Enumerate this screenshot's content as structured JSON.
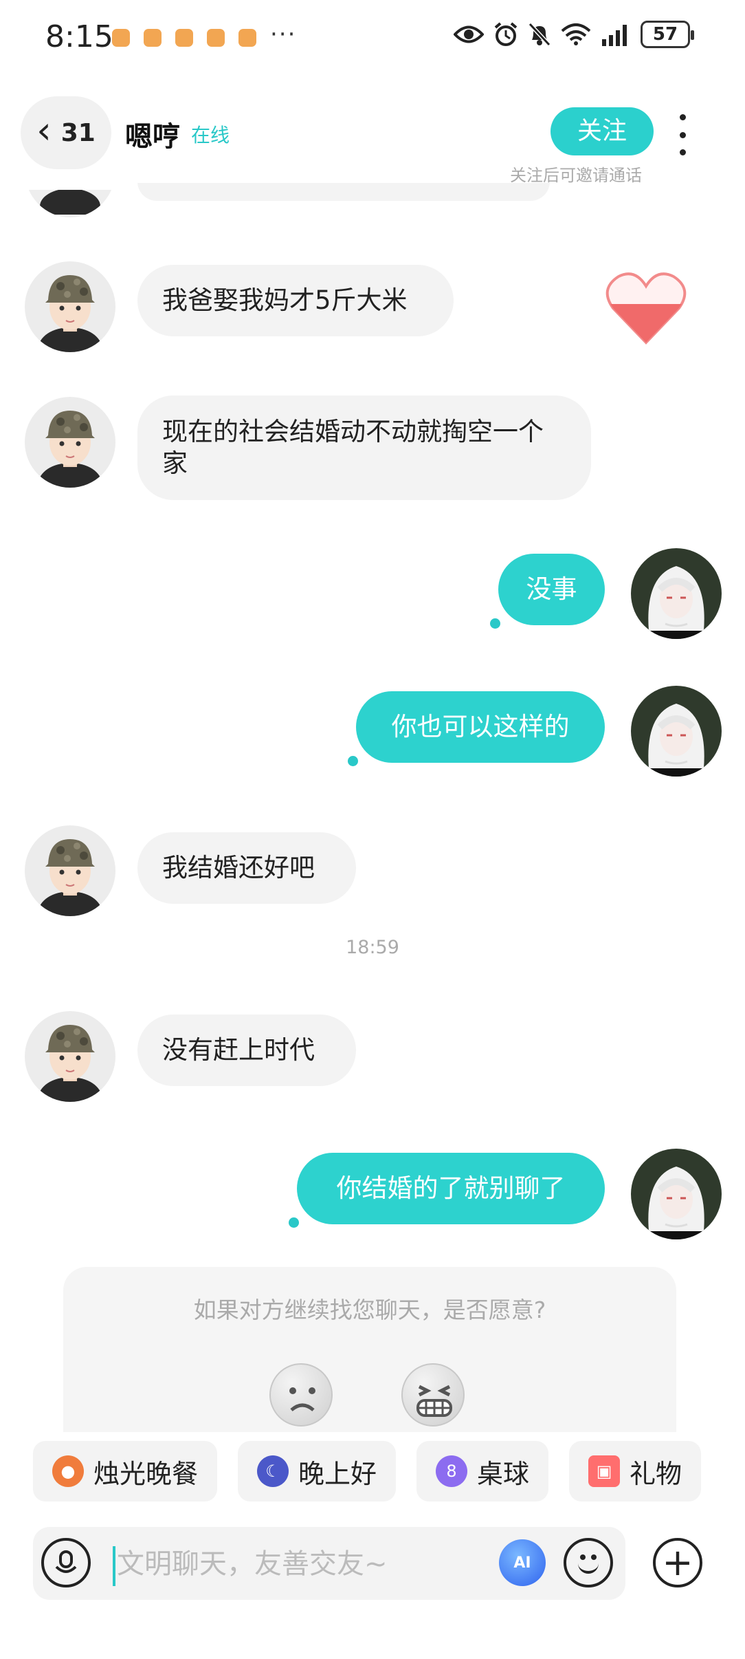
{
  "status_bar": {
    "time": "8:15",
    "more": "···",
    "battery": "57",
    "icons": [
      "eye-icon",
      "alarm-icon",
      "mute-icon",
      "wifi-icon",
      "signal-icon",
      "battery-icon"
    ]
  },
  "header": {
    "back_count": "31",
    "nickname": "嗯哼",
    "online_status": "在线",
    "follow_label": "关注",
    "follow_hint": "关注后可邀请通话"
  },
  "messages": [
    {
      "side": "in",
      "text": "我爸娶我妈才5斤大米"
    },
    {
      "side": "in",
      "text": "现在的社会结婚动不动就掏空一个家"
    },
    {
      "side": "out",
      "text": "没事"
    },
    {
      "side": "out",
      "text": "你也可以这样的"
    },
    {
      "side": "in",
      "text": "我结婚还好吧"
    },
    {
      "side": "in",
      "text": "没有赶上时代"
    },
    {
      "side": "out",
      "text": "你结婚的了就别聊了"
    }
  ],
  "timestamp": "18:59",
  "feedback": {
    "question": "如果对方继续找您聊天，是否愿意?",
    "options": [
      "sad-face-icon",
      "grin-face-icon"
    ]
  },
  "quick_actions": [
    {
      "label": "烛光晚餐",
      "icon": "dinner-icon",
      "color": "#f07c3c"
    },
    {
      "label": "晚上好",
      "icon": "moon-icon",
      "color": "#4b58c9"
    },
    {
      "label": "桌球",
      "icon": "billiard-ball-icon",
      "color": "#8c6cf0"
    },
    {
      "label": "礼物",
      "icon": "gift-icon",
      "color": "#ff6e6e"
    }
  ],
  "input": {
    "placeholder": "文明聊天，友善交友~",
    "ai_label": "AI"
  },
  "colors": {
    "accent": "#2dd2ce",
    "incoming_bubble": "#f3f3f3"
  }
}
